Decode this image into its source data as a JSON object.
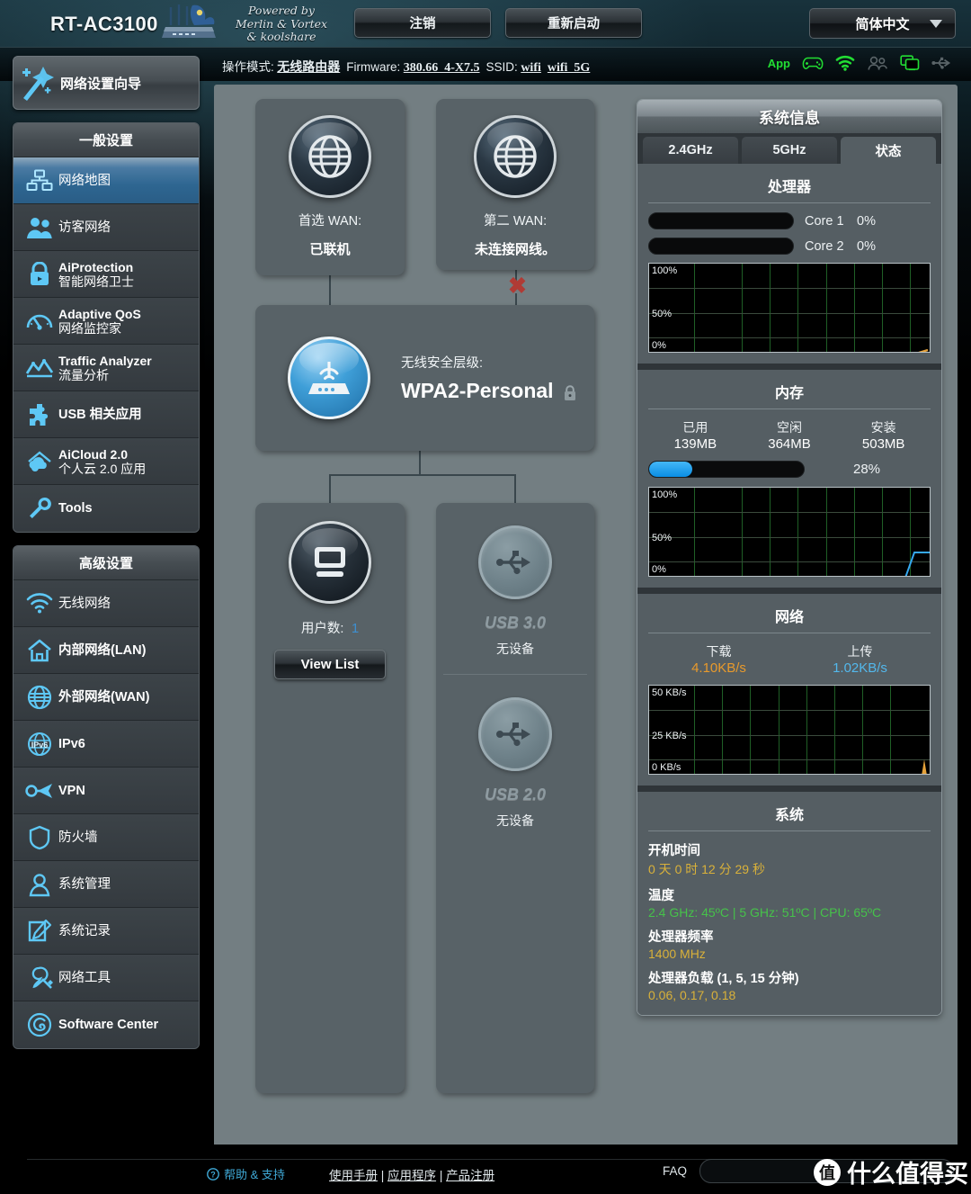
{
  "header": {
    "model": "RT-AC3100",
    "powered_by": "Powered by\nMerlin & Vortex\n& koolshare",
    "powered_line1": "Powered by",
    "powered_line2": "Merlin & Vortex",
    "powered_line3": "& koolshare",
    "logout_label": "注销",
    "reboot_label": "重新启动",
    "language": "简体中文"
  },
  "infostrip": {
    "mode_label": "操作模式:",
    "mode_value": "无线路由器",
    "firmware_label": "Firmware:",
    "firmware_value": "380.66_4-X7.5",
    "ssid_label": "SSID:",
    "ssid_1": "wifi",
    "ssid_2": "wifi_5G",
    "app_label": "App",
    "icons": [
      "game-controller-icon",
      "wifi-signal-icon",
      "guest-users-icon",
      "devices-icon",
      "usb-icon"
    ]
  },
  "sidebar": {
    "wizard_label": "网络设置向导",
    "general": {
      "title": "一般设置",
      "items": [
        {
          "icon": "network-map-icon",
          "en": "",
          "cn": "网络地图",
          "active": true
        },
        {
          "icon": "guest-network-icon",
          "en": "",
          "cn": "访客网络",
          "active": false
        },
        {
          "icon": "lock-shield-icon",
          "en": "AiProtection",
          "cn": "智能网络卫士",
          "active": false
        },
        {
          "icon": "gauge-icon",
          "en": "Adaptive QoS",
          "cn": "网络监控家",
          "active": false
        },
        {
          "icon": "chart-line-icon",
          "en": "Traffic Analyzer",
          "cn": "流量分析",
          "active": false
        },
        {
          "icon": "puzzle-icon",
          "en": "",
          "cn": "USB 相关应用",
          "active": false
        },
        {
          "icon": "cloud-house-icon",
          "en": "AiCloud 2.0",
          "cn": "个人云 2.0 应用",
          "active": false
        },
        {
          "icon": "wrench-icon",
          "en": "Tools",
          "cn": "",
          "active": false
        }
      ]
    },
    "advanced": {
      "title": "高级设置",
      "items": [
        {
          "icon": "wifi-icon",
          "label": "无线网络"
        },
        {
          "icon": "house-icon",
          "label": "内部网络(LAN)"
        },
        {
          "icon": "globe-icon",
          "label": "外部网络(WAN)"
        },
        {
          "icon": "ipv6-globe-icon",
          "label": "IPv6"
        },
        {
          "icon": "vpn-key-icon",
          "label": "VPN"
        },
        {
          "icon": "firewall-shield-icon",
          "label": "防火墙"
        },
        {
          "icon": "admin-user-icon",
          "label": "系统管理"
        },
        {
          "icon": "log-pencil-icon",
          "label": "系统记录"
        },
        {
          "icon": "network-tools-icon",
          "label": "网络工具"
        },
        {
          "icon": "software-center-icon",
          "label": "Software Center"
        }
      ]
    }
  },
  "network_map": {
    "wan1": {
      "icon": "globe-icon",
      "label": "首选 WAN:",
      "status": "已联机"
    },
    "wan2": {
      "icon": "globe-icon",
      "label": "第二 WAN:",
      "status": "未连接网线。"
    },
    "router": {
      "icon": "router-icon",
      "security_label": "无线安全层级:",
      "security_value": "WPA2-Personal",
      "lock_icon": "lock-icon"
    },
    "clients": {
      "icon": "monitor-icon",
      "count_label": "用户数:",
      "count_value": "1",
      "view_list_label": "View List"
    },
    "usb": [
      {
        "icon": "usb-icon",
        "title": "USB 3.0",
        "status": "无设备"
      },
      {
        "icon": "usb-icon",
        "title": "USB 2.0",
        "status": "无设备"
      }
    ]
  },
  "sysinfo": {
    "title": "系统信息",
    "tabs": [
      {
        "label": "2.4GHz",
        "active": false
      },
      {
        "label": "5GHz",
        "active": false
      },
      {
        "label": "状态",
        "active": true
      }
    ],
    "cpu": {
      "title": "处理器",
      "cores": [
        {
          "name": "Core 1",
          "percent": "0%",
          "value": 0
        },
        {
          "name": "Core 2",
          "percent": "0%",
          "value": 0
        }
      ],
      "axis": [
        "100%",
        "50%",
        "0%"
      ]
    },
    "memory": {
      "title": "内存",
      "used_label": "已用",
      "used_value": "139MB",
      "free_label": "空闲",
      "free_value": "364MB",
      "total_label": "安装",
      "total_value": "503MB",
      "percent_label": "28%",
      "percent": 28,
      "axis": [
        "100%",
        "50%",
        "0%"
      ]
    },
    "network": {
      "title": "网络",
      "download_label": "下载",
      "download_value": "4.10KB/s",
      "upload_label": "上传",
      "upload_value": "1.02KB/s",
      "axis": [
        "50 KB/s",
        "25 KB/s",
        "0 KB/s"
      ]
    },
    "system": {
      "title": "系统",
      "uptime_label": "开机时间",
      "uptime_value": "0 天 0 时 12 分 29 秒",
      "temp_label": "温度",
      "temp_value": "2.4 GHz: 45ºC | 5 GHz: 51ºC | CPU: 65ºC",
      "freq_label": "处理器频率",
      "freq_value": "1400 MHz",
      "load_label": "处理器负载 (1, 5, 15 分钟)",
      "load_value": "0.06,  0.17,  0.18"
    }
  },
  "footer": {
    "help_icon": "question-mark-icon",
    "help_label": "帮助 & 支持",
    "manual_label": "使用手册",
    "apps_label": "应用程序",
    "register_label": "产品注册",
    "sep": "|",
    "faq_label": "FAQ",
    "watermark_badge": "值",
    "watermark_text": "什么值得买"
  },
  "colors": {
    "accent_blue": "#2e6691",
    "panel_gray": "#737e82",
    "tile_gray": "#586267",
    "green": "#22dd33",
    "amber": "#d9b13a",
    "download_orange": "#e89a2c",
    "upload_blue": "#53b8ec"
  }
}
